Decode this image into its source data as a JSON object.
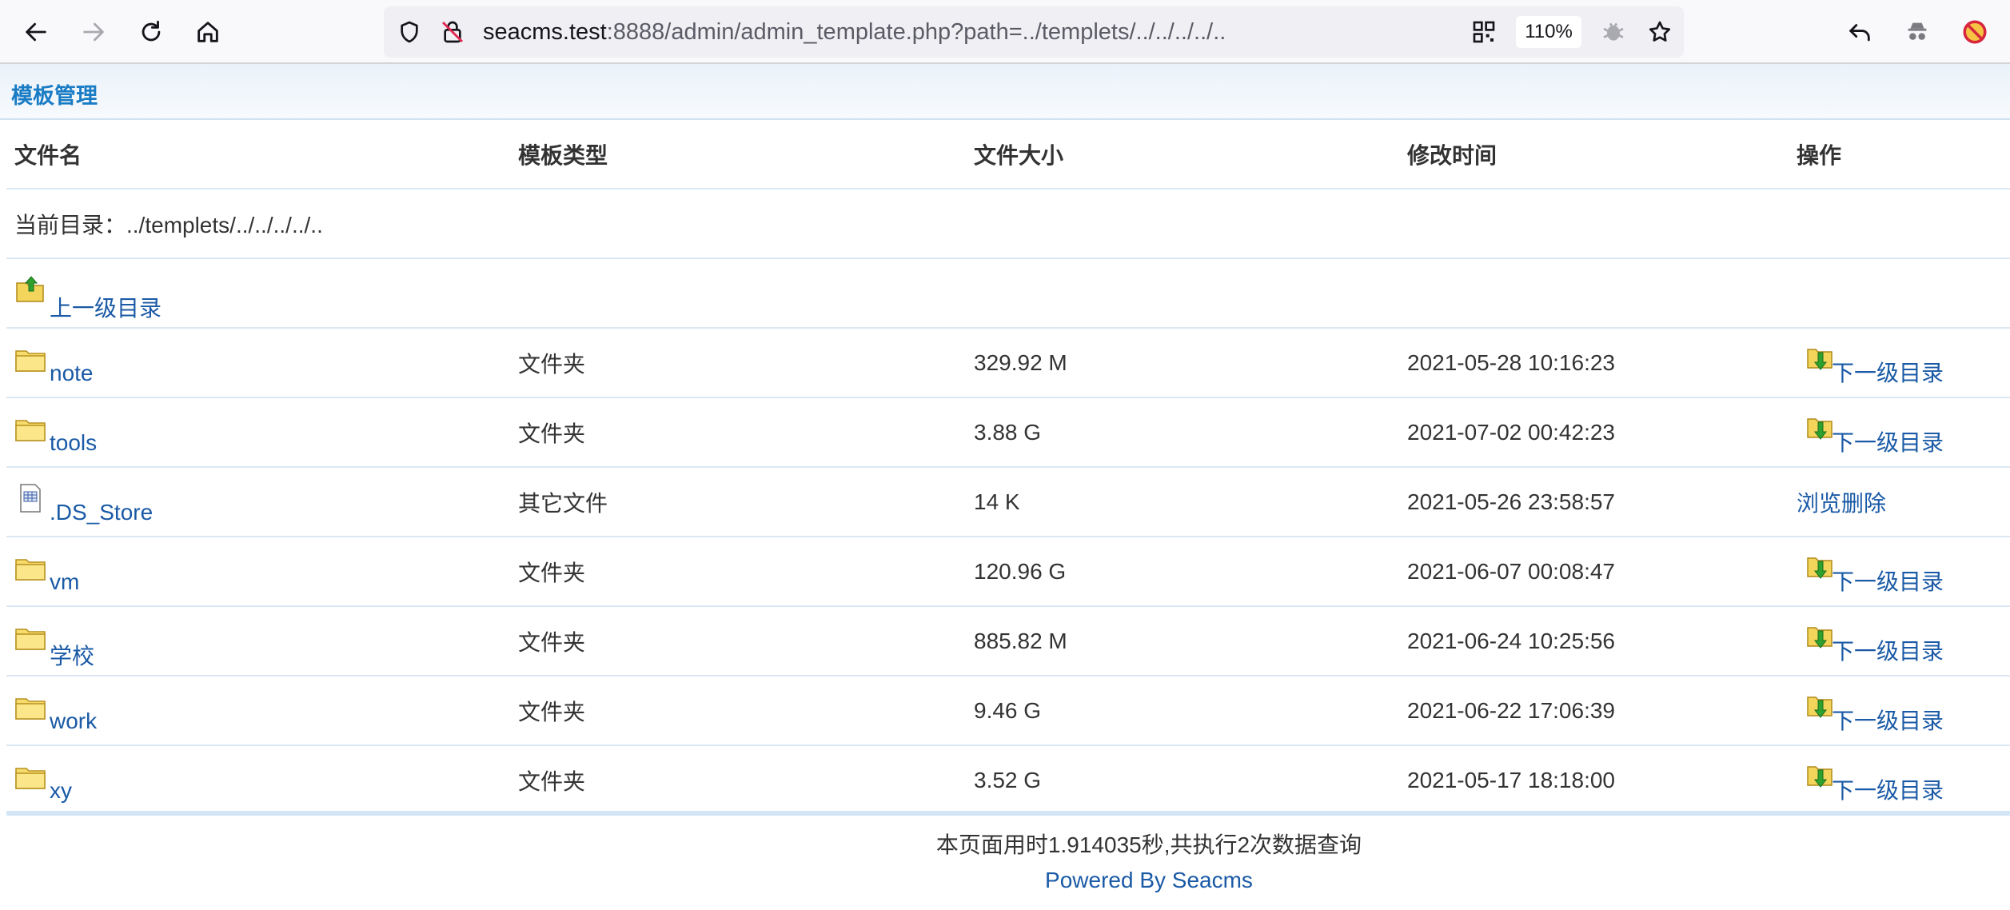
{
  "browser": {
    "url_host": "seacms.test",
    "url_rest": ":8888/admin/admin_template.php?path=../templets/../../../../..",
    "zoom": "110%"
  },
  "page": {
    "section_title": "模板管理",
    "columns": [
      "文件名",
      "模板类型",
      "文件大小",
      "修改时间",
      "操作"
    ],
    "current_dir_label": "当前目录：../templets/../../../../..",
    "parent_dir_label": "上一级目录",
    "rows": [
      {
        "name": "note",
        "type": "文件夹",
        "size": "329.92 M",
        "mtime": "2021-05-28 10:16:23",
        "icon": "folder-icon",
        "action": "下一级目录"
      },
      {
        "name": "tools",
        "type": "文件夹",
        "size": "3.88 G",
        "mtime": "2021-07-02 00:42:23",
        "icon": "folder-icon",
        "action": "下一级目录"
      },
      {
        "name": ".DS_Store",
        "type": "其它文件",
        "size": "14 K",
        "mtime": "2021-05-26 23:58:57",
        "icon": "file-icon",
        "action_view": "浏览",
        "action_delete": "删除"
      },
      {
        "name": "vm",
        "type": "文件夹",
        "size": "120.96 G",
        "mtime": "2021-06-07 00:08:47",
        "icon": "folder-icon",
        "action": "下一级目录"
      },
      {
        "name": "学校",
        "type": "文件夹",
        "size": "885.82 M",
        "mtime": "2021-06-24 10:25:56",
        "icon": "folder-icon",
        "action": "下一级目录"
      },
      {
        "name": "work",
        "type": "文件夹",
        "size": "9.46 G",
        "mtime": "2021-06-22 17:06:39",
        "icon": "folder-icon",
        "action": "下一级目录"
      },
      {
        "name": "xy",
        "type": "文件夹",
        "size": "3.52 G",
        "mtime": "2021-05-17 18:18:00",
        "icon": "folder-icon",
        "action": "下一级目录"
      }
    ],
    "footer_stats": "本页面用时1.914035秒,共执行2次数据查询",
    "footer_powered": "Powered By Seacms"
  },
  "colors": {
    "link": "#1a5aa6",
    "title": "#1a7cc4",
    "divider": "#dbe8f3"
  }
}
